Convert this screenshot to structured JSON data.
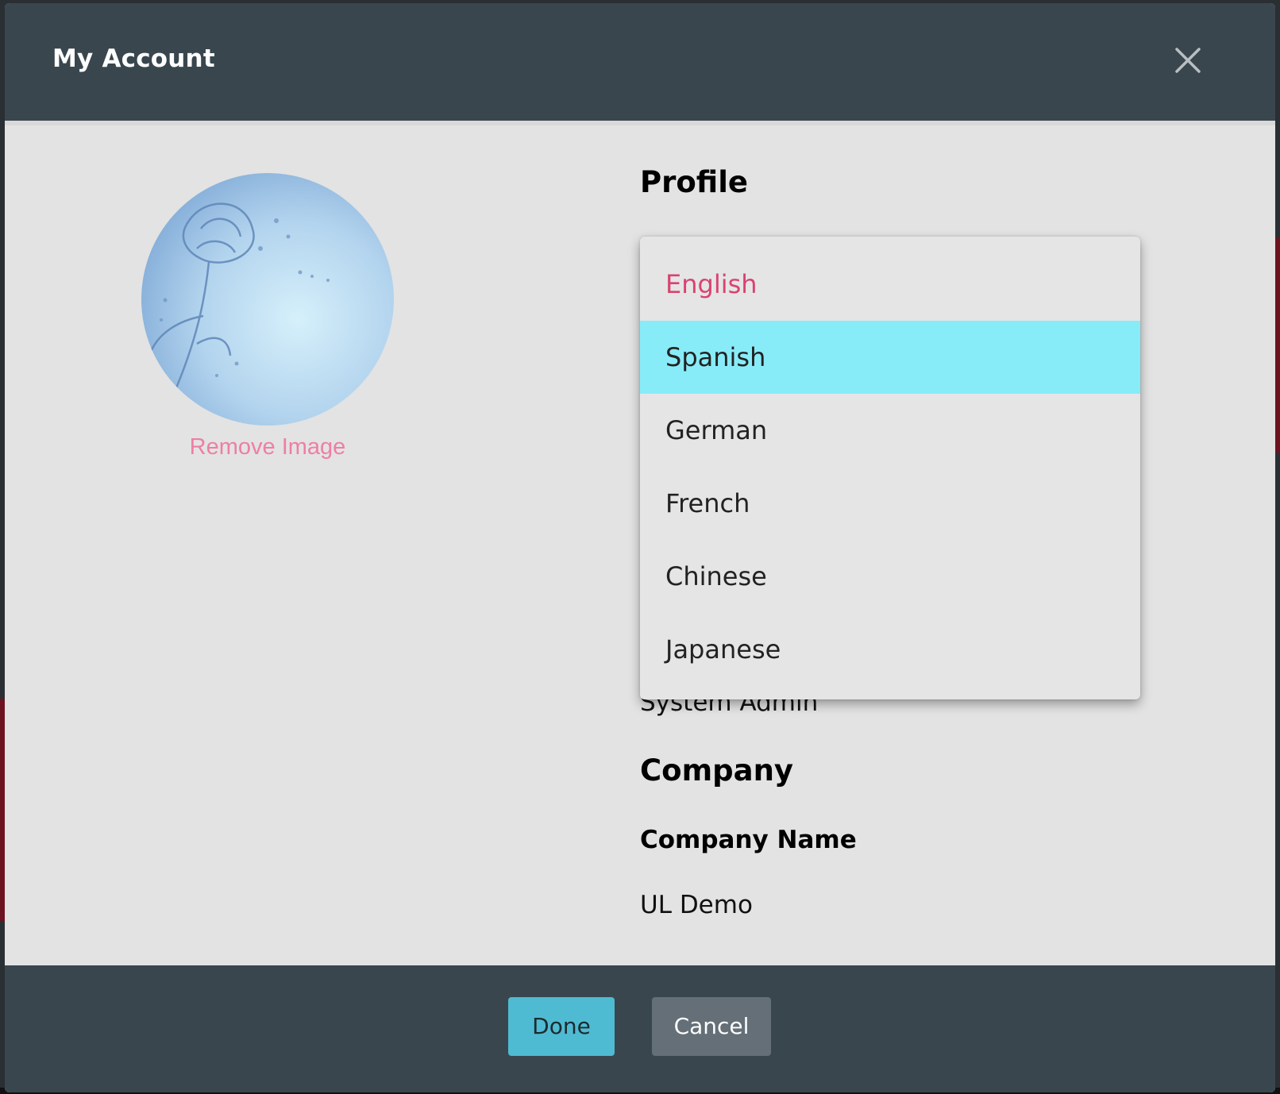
{
  "dialog": {
    "title": "My Account",
    "close_icon": "close-icon"
  },
  "avatar": {
    "remove_label": "Remove Image"
  },
  "profile": {
    "heading": "Profile",
    "role_value": "System Admin"
  },
  "language_dropdown": {
    "selected": "English",
    "hovered": "Spanish",
    "options": [
      "English",
      "Spanish",
      "German",
      "French",
      "Chinese",
      "Japanese"
    ]
  },
  "company": {
    "heading": "Company",
    "name_label": "Company Name",
    "name_value": "UL Demo"
  },
  "footer": {
    "done_label": "Done",
    "cancel_label": "Cancel"
  },
  "colors": {
    "header_bg": "#39464e",
    "body_bg": "#e3e3e3",
    "accent_pink": "#d9436f",
    "hover_cyan": "#88ecf8",
    "done_bg": "#4fbbd2",
    "cancel_bg": "#646f77"
  }
}
